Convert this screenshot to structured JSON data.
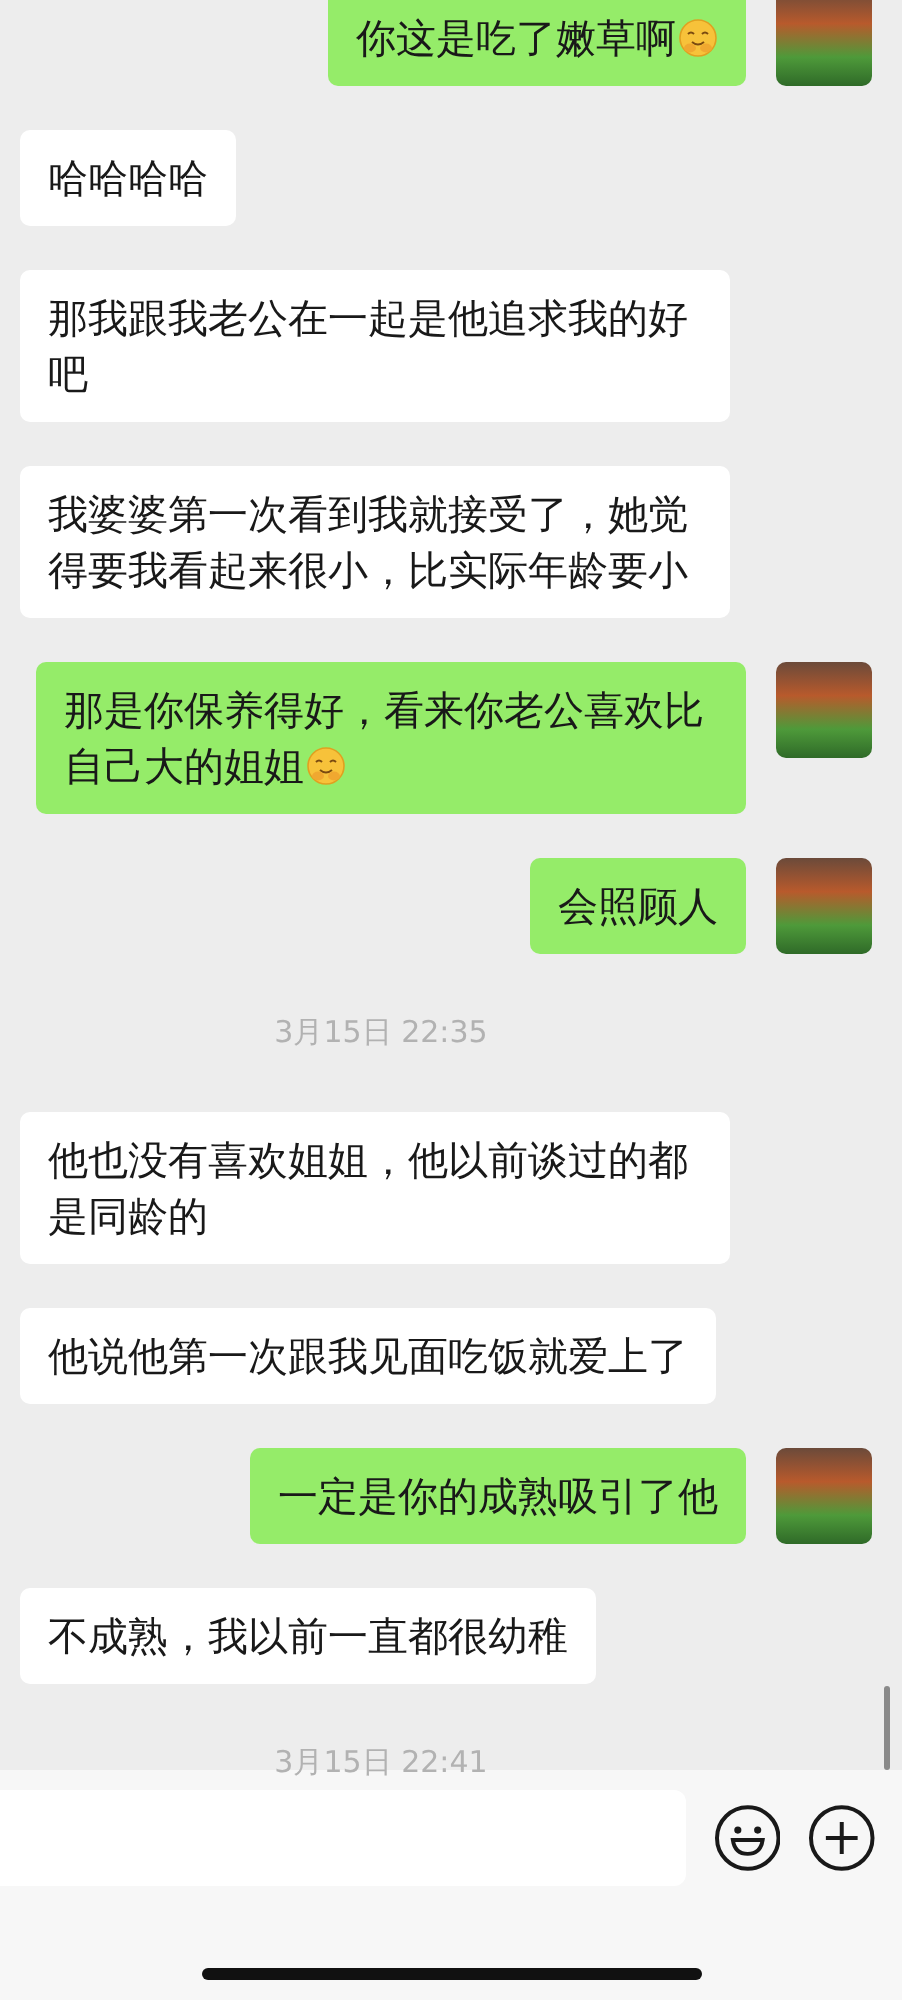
{
  "messages": [
    {
      "kind": "sent",
      "text": "你这是吃了嫩草啊",
      "emoji": true
    },
    {
      "kind": "received",
      "text": "哈哈哈哈",
      "emoji": false
    },
    {
      "kind": "received",
      "text": "那我跟我老公在一起是他追求我的好吧",
      "emoji": false
    },
    {
      "kind": "received",
      "text": "我婆婆第一次看到我就接受了，她觉得要我看起来很小，比实际年龄要小",
      "emoji": false
    },
    {
      "kind": "sent",
      "text": "那是你保养得好，看来你老公喜欢比自己大的姐姐",
      "emoji": true
    },
    {
      "kind": "sent",
      "text": "会照顾人",
      "emoji": false
    },
    {
      "kind": "time",
      "text": "3月15日 22:35"
    },
    {
      "kind": "received",
      "text": "他也没有喜欢姐姐，他以前谈过的都是同龄的",
      "emoji": false
    },
    {
      "kind": "received",
      "text": "他说他第一次跟我见面吃饭就爱上了",
      "emoji": false
    },
    {
      "kind": "sent",
      "text": "一定是你的成熟吸引了他",
      "emoji": false
    },
    {
      "kind": "received",
      "text": "不成熟，我以前一直都很幼稚",
      "emoji": false
    },
    {
      "kind": "time",
      "text": "3月15日 22:41"
    }
  ]
}
